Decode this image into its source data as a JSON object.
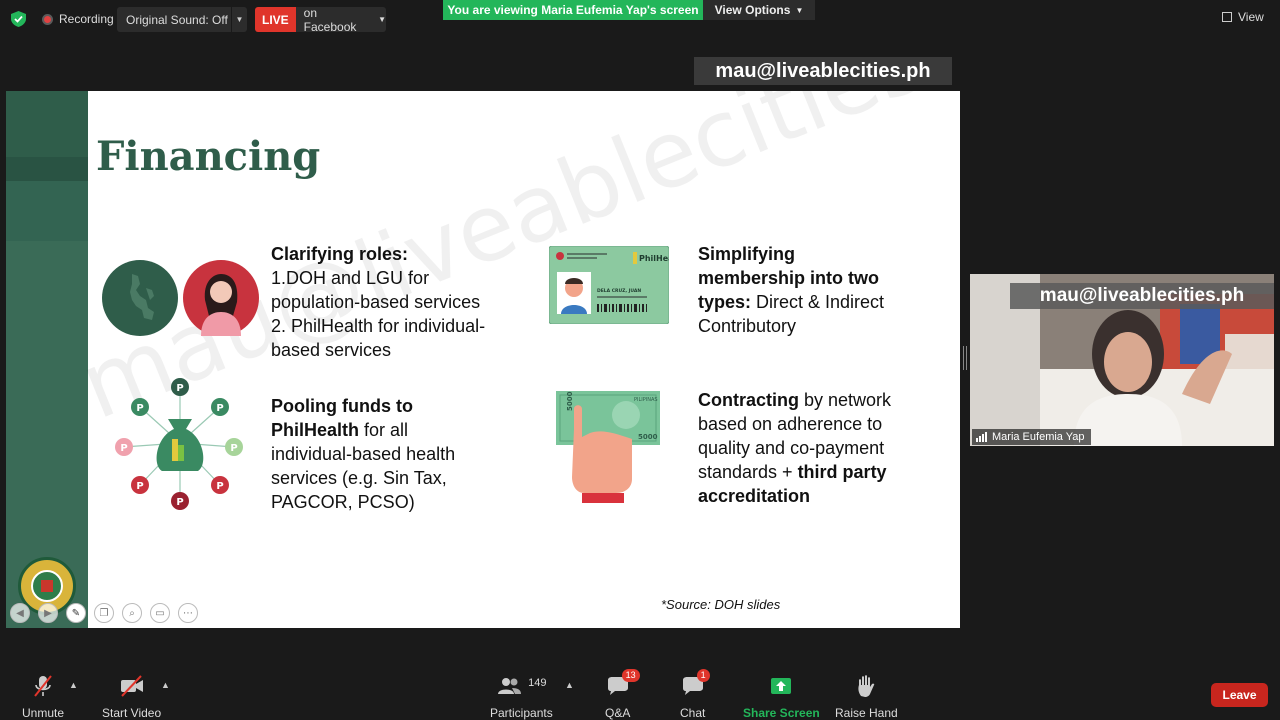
{
  "topbar": {
    "recording_label": "Recording",
    "original_sound": "Original Sound: Off",
    "live_badge": "LIVE",
    "live_target": "on Facebook",
    "viewing_banner": "You are viewing Maria Eufemia Yap's screen",
    "view_options": "View Options",
    "view_label": "View"
  },
  "email_overlay": "mau@liveablecities.ph",
  "slide": {
    "title": "Financing",
    "block1": {
      "heading": "Clarifying roles:",
      "line1": "1.DOH and LGU for",
      "line2": "population-based services",
      "line3": "2. PhilHealth for individual-",
      "line4": "based services"
    },
    "block2": {
      "bold1": "Pooling funds to",
      "bold2": "PhilHealth",
      "rest1": " for all",
      "line3": "individual-based health",
      "line4": "services (e.g. Sin Tax,",
      "line5": "PAGCOR, PCSO)"
    },
    "block3": {
      "bold1": "Simplifying",
      "bold2": "membership into two",
      "bold3": "types:",
      "rest3": " Direct & Indirect",
      "line4": "Contributory"
    },
    "block4": {
      "bold1": "Contracting",
      "rest1": " by network",
      "line2": "based on adherence to",
      "line3": "quality and co-payment",
      "line4_pre": "standards + ",
      "line4_bold": "third party",
      "line5_bold": "accreditation"
    },
    "source": "*Source: DOH slides",
    "watermark": "mau@liveablecities.ph",
    "card": {
      "brand": "PhilHealth",
      "name": "DELA CRUZ, JUAN"
    },
    "bill": {
      "country": "PILIPINAS",
      "value": "5000"
    }
  },
  "video": {
    "email_overlay": "mau@liveablecities.ph",
    "participant_name": "Maria Eufemia Yap"
  },
  "toolbar": {
    "unmute": "Unmute",
    "start_video": "Start Video",
    "participants": "Participants",
    "participants_count": "149",
    "qa": "Q&A",
    "qa_badge": "13",
    "chat": "Chat",
    "chat_badge": "1",
    "share_screen": "Share Screen",
    "raise_hand": "Raise Hand",
    "leave": "Leave"
  },
  "colors": {
    "accent_green": "#23b65a",
    "live_red": "#e0352b",
    "slide_green": "#2f5d4a",
    "leave_red": "#c8261e"
  }
}
